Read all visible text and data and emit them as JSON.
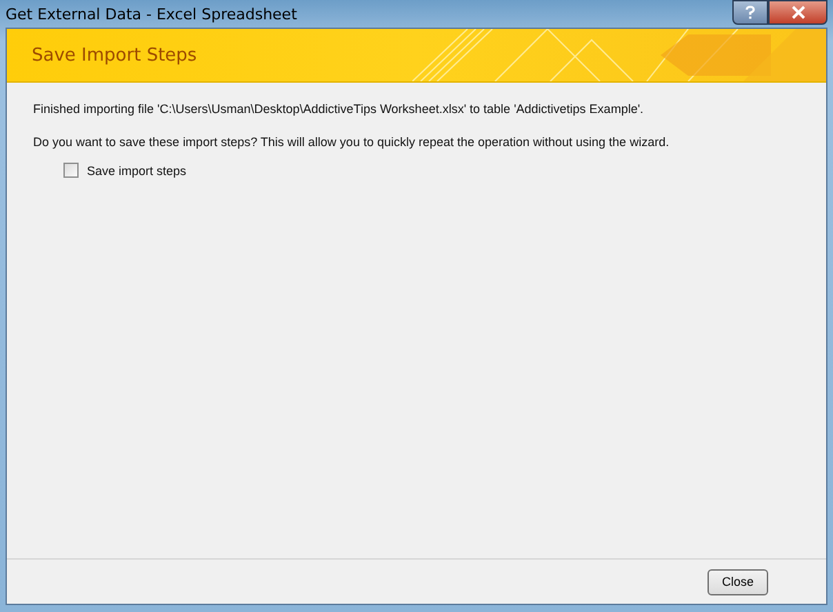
{
  "window": {
    "title": "Get External Data - Excel Spreadsheet"
  },
  "header": {
    "title": "Save Import Steps"
  },
  "messages": [
    "Finished importing file 'C:\\Users\\Usman\\Desktop\\AddictiveTips Worksheet.xlsx' to table 'Addictivetips Example'.",
    "Do you want to save these import steps? This will allow you to quickly repeat the operation without using the wizard."
  ],
  "save_option": {
    "label": "Save import steps",
    "checked": false
  },
  "buttons": [
    "Close"
  ]
}
